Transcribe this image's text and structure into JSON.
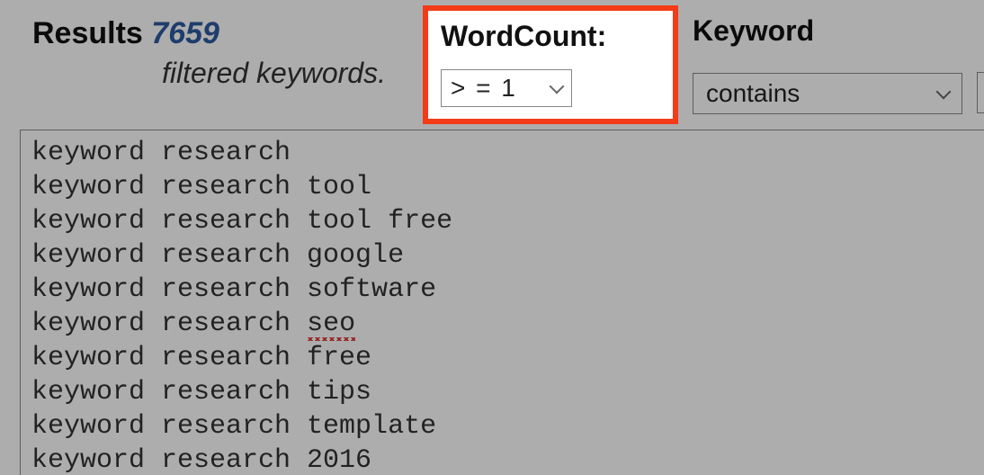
{
  "results": {
    "label": "Results",
    "count": "7659",
    "subtitle": "filtered keywords."
  },
  "wordcount": {
    "label": "WordCount:",
    "selected": "> = 1"
  },
  "keyword_filter": {
    "label": "Keyword",
    "selected": "contains"
  },
  "keywords": [
    "keyword research",
    "keyword research tool",
    "keyword research tool free",
    "keyword research google",
    "keyword research software",
    "keyword research seo",
    "keyword research free",
    "keyword research tips",
    "keyword research template",
    "keyword research 2016"
  ],
  "spellcheck_flag_index": 5,
  "spellcheck_flag_word": "seo"
}
